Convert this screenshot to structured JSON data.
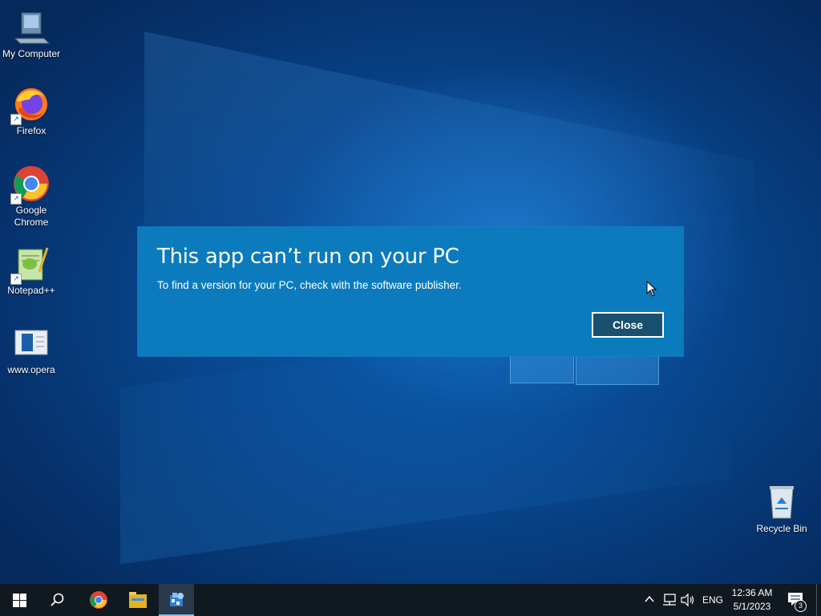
{
  "desktop": {
    "icons": [
      {
        "label": "My Computer",
        "icon": "computer-icon"
      },
      {
        "label": "Firefox",
        "icon": "firefox-icon"
      },
      {
        "label": "Google Chrome",
        "icon": "chrome-icon"
      },
      {
        "label": "Notepad++",
        "icon": "notepad-plus-plus-icon"
      },
      {
        "label": "www.opera",
        "icon": "document-icon"
      },
      {
        "label": "Recycle Bin",
        "icon": "recycle-bin-icon"
      }
    ]
  },
  "dialog": {
    "title": "This app can’t run on your PC",
    "message": "To find a version for your PC, check with the software publisher.",
    "close_label": "Close"
  },
  "taskbar": {
    "apps": [
      "start-icon",
      "search-icon",
      "chrome-icon",
      "file-explorer-icon",
      "app-installer-icon"
    ],
    "tray": {
      "language": "ENG",
      "time": "12:36 AM",
      "date": "5/1/2023",
      "notification_count": "3"
    }
  },
  "colors": {
    "dialog_bg": "#0b7bbd",
    "taskbar_bg": "#101820",
    "desktop_bg": "#08478f"
  }
}
